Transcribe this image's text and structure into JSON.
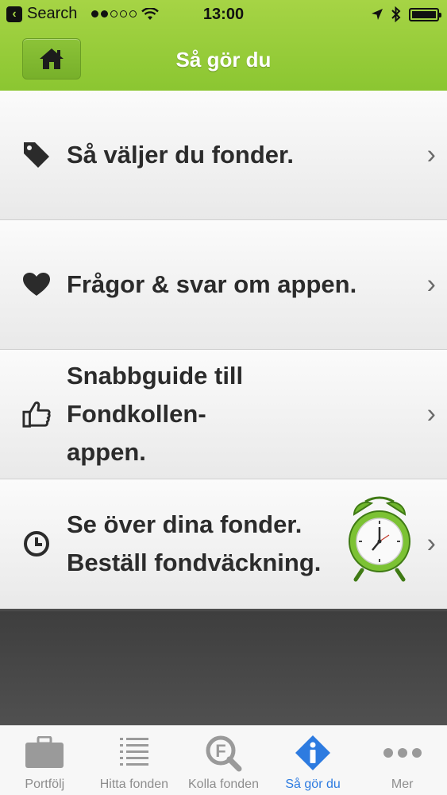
{
  "status_bar": {
    "back_label": "Search",
    "time": "13:00",
    "signal_bars_filled": 2,
    "signal_bars_total": 5
  },
  "nav": {
    "title": "Så gör du"
  },
  "menu": {
    "items": [
      {
        "lines": [
          "Så väljer du fonder."
        ],
        "icon": "tag-icon"
      },
      {
        "lines": [
          "Frågor & svar om appen."
        ],
        "icon": "heart-icon"
      },
      {
        "lines": [
          "Snabbguide till Fondkollen-",
          "appen."
        ],
        "icon": "thumbs-up-icon"
      },
      {
        "lines": [
          "Se över dina fonder.",
          "Beställ fondväckning."
        ],
        "icon": "clock-icon"
      }
    ]
  },
  "tabs": [
    {
      "label": "Portfölj",
      "icon": "briefcase-icon"
    },
    {
      "label": "Hitta fonden",
      "icon": "list-icon"
    },
    {
      "label": "Kolla fonden",
      "icon": "fund-search-icon"
    },
    {
      "label": "Så gör du",
      "icon": "info-icon",
      "active": true
    },
    {
      "label": "Mer",
      "icon": "more-icon"
    }
  ],
  "colors": {
    "header_green": "#9acd3a",
    "active_tab": "#2d7be0",
    "inactive_tab": "#8d8d8d"
  }
}
